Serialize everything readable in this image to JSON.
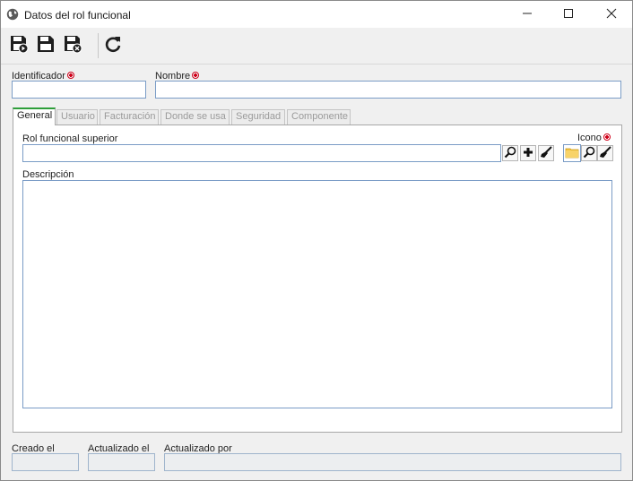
{
  "window": {
    "title": "Datos del rol funcional"
  },
  "toolbar": {
    "save_new_icon": "save-new-icon",
    "save_icon": "save-icon",
    "save_close_icon": "save-close-icon",
    "refresh_icon": "refresh-icon"
  },
  "form": {
    "identificador_label": "Identificador",
    "identificador_value": "",
    "nombre_label": "Nombre",
    "nombre_value": ""
  },
  "tabs": [
    {
      "label": "General",
      "active": true
    },
    {
      "label": "Usuario",
      "active": false
    },
    {
      "label": "Facturación",
      "active": false
    },
    {
      "label": "Donde se usa",
      "active": false
    },
    {
      "label": "Seguridad",
      "active": false
    },
    {
      "label": "Componente",
      "active": false
    }
  ],
  "general": {
    "rol_superior_label": "Rol funcional superior",
    "rol_superior_value": "",
    "icono_label": "Icono",
    "descripcion_label": "Descripción",
    "descripcion_value": ""
  },
  "footer": {
    "creado_label": "Creado el",
    "creado_value": "",
    "actualizado_label": "Actualizado el",
    "actualizado_value": "",
    "actualizado_por_label": "Actualizado por",
    "actualizado_por_value": ""
  },
  "colors": {
    "accent_tab": "#2e9e3a",
    "required": "#d0021b",
    "field_border": "#7a9cc6"
  }
}
